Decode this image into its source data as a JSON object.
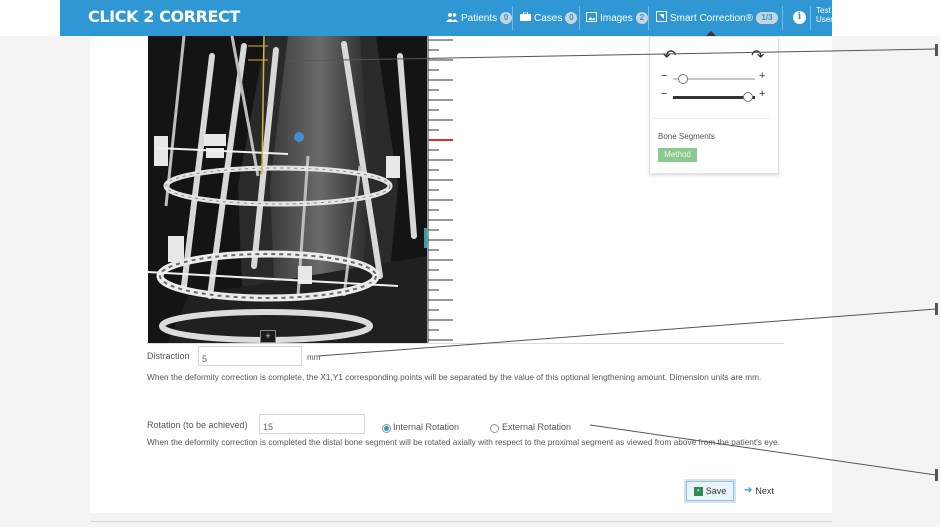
{
  "app": {
    "brand": "CLICK 2 CORRECT"
  },
  "nav": {
    "patients": {
      "label": "Patients",
      "badge": "0",
      "icon": "users-icon"
    },
    "cases": {
      "label": "Cases",
      "badge": "0",
      "icon": "briefcase-icon"
    },
    "images": {
      "label": "Images",
      "badge": "2",
      "icon": "image-icon"
    },
    "smart_correction": {
      "label": "Smart Correction®",
      "badge": "1/3",
      "icon": "smart-correction-icon"
    },
    "info_icon": "info-icon",
    "user": {
      "line1": "Test",
      "line2": "User"
    }
  },
  "controls": {
    "undo_icon": "undo-icon",
    "redo_icon": "redo-icon",
    "minus": "−",
    "plus": "+",
    "opacity_level": 0.1,
    "contrast_level": 0.95,
    "bone_segments_label": "Bone Segments",
    "method_button": "Method"
  },
  "image": {
    "expand_label": "+"
  },
  "form": {
    "distraction_label": "Distraction",
    "distraction_value": "5",
    "distraction_unit": "mm",
    "distraction_help": "When the deformity correction is complete, the X1,Y1 corresponding points will be separated by the value of this optional lengthening amount. Dimension units are mm.",
    "rotation_label": "Rotation (to be achieved)",
    "rotation_value": "15",
    "internal_rotation": "Internal Rotation",
    "external_rotation": "External Rotation",
    "selected_rotation": "internal",
    "rotation_help": "When the deformity correction is completed the distal bone segment will be rotated axially with respect to the proximal segment as viewed from above from the patient's eye.",
    "save_label": "Save",
    "next_label": "Next"
  },
  "colors": {
    "accent": "#2f97d4",
    "method": "#8cc98c",
    "ruler_marker": "#d9302c"
  }
}
